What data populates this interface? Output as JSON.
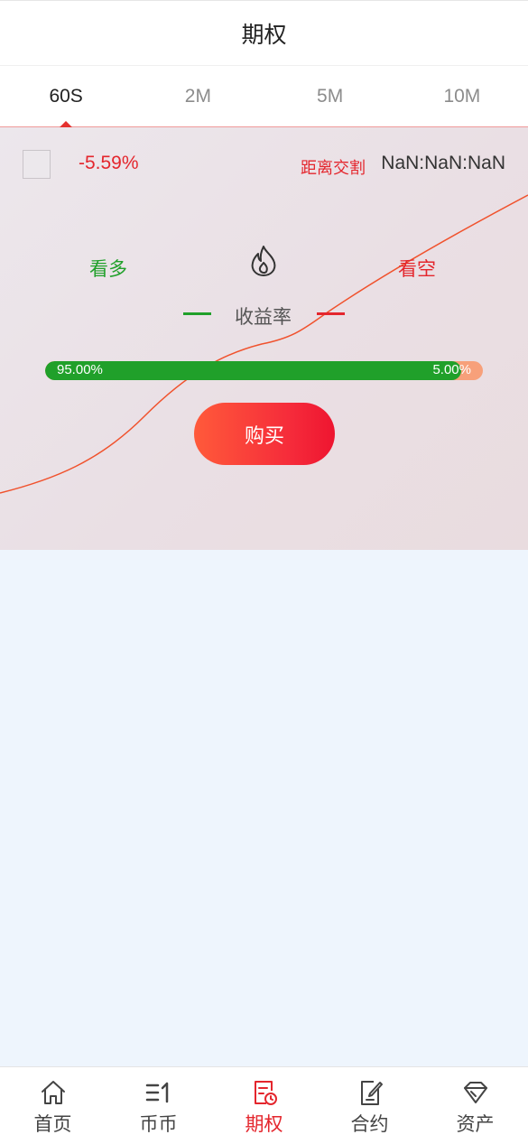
{
  "header": {
    "title": "期权"
  },
  "tabs": [
    {
      "label": "60S",
      "active": true
    },
    {
      "label": "2M",
      "active": false
    },
    {
      "label": "5M",
      "active": false
    },
    {
      "label": "10M",
      "active": false
    }
  ],
  "trade": {
    "change_percent": "-5.59%",
    "countdown_label": "距离交割",
    "countdown_value": "NaN:NaN:NaN",
    "bull_label": "看多",
    "bear_label": "看空",
    "yield_label": "收益率",
    "ratio_left": "95.00%",
    "ratio_right": "5.00%",
    "ratio_fraction": 0.95,
    "buy_label": "购买"
  },
  "colors": {
    "accent_red": "#e4262d",
    "bull_green": "#20a02a",
    "chart_line": "#f0522d"
  },
  "bottom_nav": [
    {
      "label": "首页",
      "icon": "home-icon",
      "active": false
    },
    {
      "label": "币币",
      "icon": "exchange-icon",
      "active": false
    },
    {
      "label": "期权",
      "icon": "options-icon",
      "active": true
    },
    {
      "label": "合约",
      "icon": "contract-icon",
      "active": false
    },
    {
      "label": "资产",
      "icon": "diamond-icon",
      "active": false
    }
  ]
}
